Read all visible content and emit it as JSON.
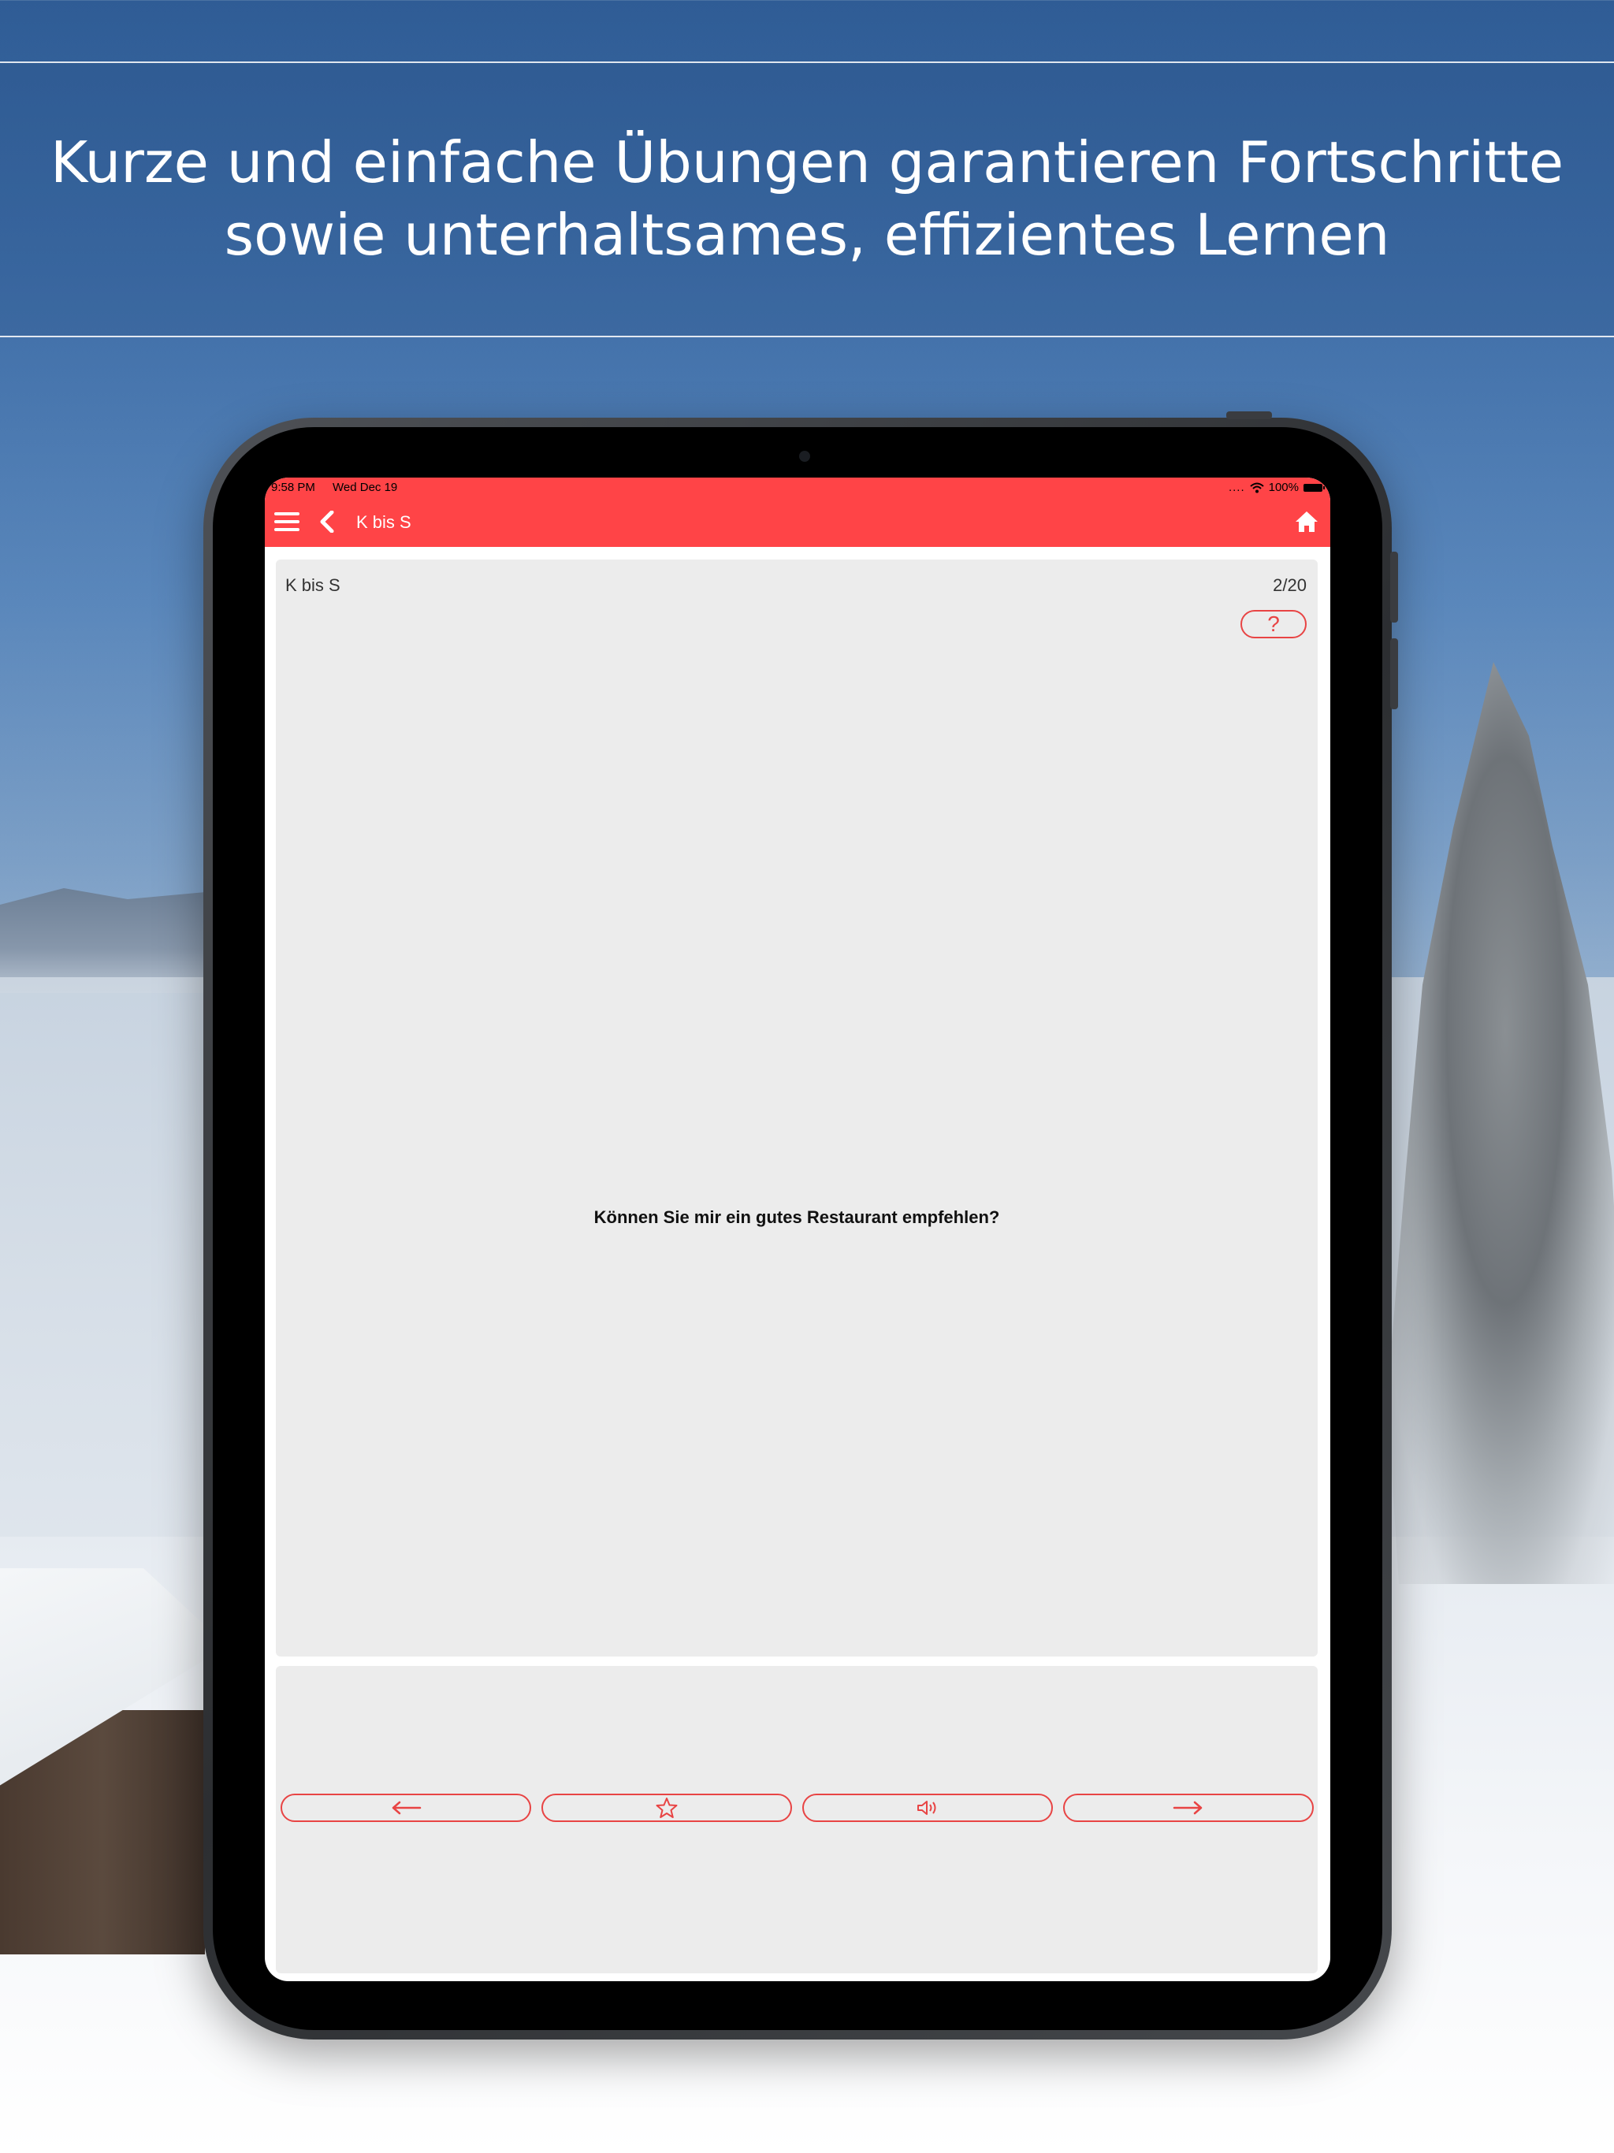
{
  "headline": {
    "line1": "Kurze und einfache Übungen garantieren Fortschritte",
    "line2": "sowie unterhaltsames, effizientes Lernen"
  },
  "status_bar": {
    "time": "9:58 PM",
    "date": "Wed Dec 19",
    "battery": "100%"
  },
  "navbar": {
    "title": "K bis S",
    "icons": [
      "menu-icon",
      "back-chevron-icon",
      "home-icon"
    ]
  },
  "card": {
    "deck_title": "K bis S",
    "progress": "2/20",
    "help_label": "?",
    "question": "Können Sie mir ein gutes Restaurant empfehlen?"
  },
  "controls": [
    "arrow-left-icon",
    "star-icon",
    "speaker-icon",
    "arrow-right-icon"
  ],
  "colors": {
    "accent": "#ff4447",
    "button_outline": "#e84444",
    "card_bg": "#ececec"
  }
}
